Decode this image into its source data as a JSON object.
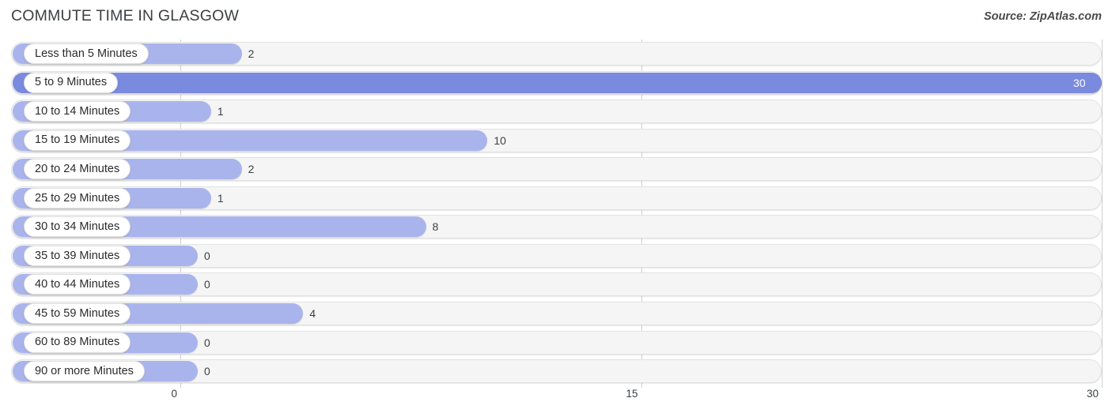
{
  "header": {
    "title": "COMMUTE TIME IN GLASGOW",
    "source": "Source: ZipAtlas.com"
  },
  "colors": {
    "bar": "#aab4ec",
    "bar_highlight": "#7a8ade",
    "track": "#f5f5f5",
    "grid": "#d0d0d0",
    "text": "#3c4043"
  },
  "chart_data": {
    "type": "bar",
    "orientation": "horizontal",
    "title": "COMMUTE TIME IN GLASGOW",
    "xlabel": "",
    "ylabel": "",
    "xlim": [
      0,
      30
    ],
    "grid": true,
    "legend": null,
    "xticks": [
      "0",
      "15",
      "30"
    ],
    "xtick_values": [
      0,
      15,
      30
    ],
    "categories": [
      "Less than 5 Minutes",
      "5 to 9 Minutes",
      "10 to 14 Minutes",
      "15 to 19 Minutes",
      "20 to 24 Minutes",
      "25 to 29 Minutes",
      "30 to 34 Minutes",
      "35 to 39 Minutes",
      "40 to 44 Minutes",
      "45 to 59 Minutes",
      "60 to 89 Minutes",
      "90 or more Minutes"
    ],
    "values": [
      2,
      30,
      1,
      10,
      2,
      1,
      8,
      0,
      0,
      4,
      0,
      0
    ],
    "value_labels": [
      "2",
      "30",
      "1",
      "10",
      "2",
      "1",
      "8",
      "0",
      "0",
      "4",
      "0",
      "0"
    ],
    "highlight_index": 1
  },
  "rows": [
    {
      "label": "Less than 5 Minutes",
      "value": 2,
      "value_label": "2",
      "highlight": false
    },
    {
      "label": "5 to 9 Minutes",
      "value": 30,
      "value_label": "30",
      "highlight": true
    },
    {
      "label": "10 to 14 Minutes",
      "value": 1,
      "value_label": "1",
      "highlight": false
    },
    {
      "label": "15 to 19 Minutes",
      "value": 10,
      "value_label": "10",
      "highlight": false
    },
    {
      "label": "20 to 24 Minutes",
      "value": 2,
      "value_label": "2",
      "highlight": false
    },
    {
      "label": "25 to 29 Minutes",
      "value": 1,
      "value_label": "1",
      "highlight": false
    },
    {
      "label": "30 to 34 Minutes",
      "value": 8,
      "value_label": "8",
      "highlight": false
    },
    {
      "label": "35 to 39 Minutes",
      "value": 0,
      "value_label": "0",
      "highlight": false
    },
    {
      "label": "40 to 44 Minutes",
      "value": 0,
      "value_label": "0",
      "highlight": false
    },
    {
      "label": "45 to 59 Minutes",
      "value": 4,
      "value_label": "4",
      "highlight": false
    },
    {
      "label": "60 to 89 Minutes",
      "value": 0,
      "value_label": "0",
      "highlight": false
    },
    {
      "label": "90 or more Minutes",
      "value": 0,
      "value_label": "0",
      "highlight": false
    }
  ],
  "axis": {
    "ticks": [
      {
        "label": "0",
        "value": 0
      },
      {
        "label": "15",
        "value": 15
      },
      {
        "label": "30",
        "value": 30
      }
    ]
  }
}
